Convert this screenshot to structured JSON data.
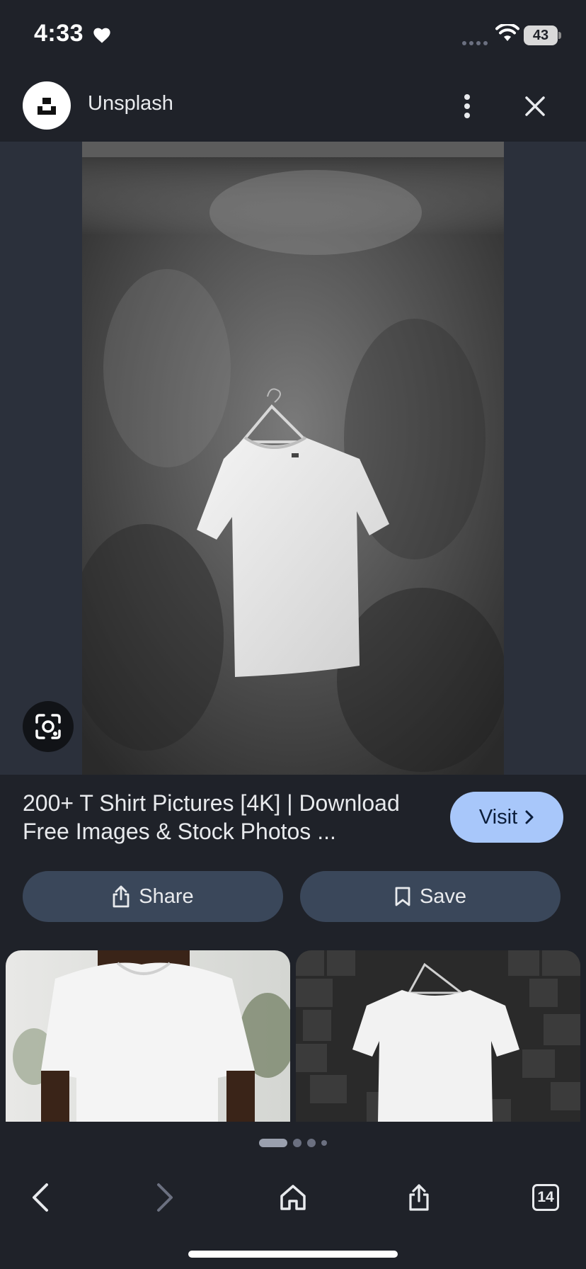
{
  "status_bar": {
    "time": "4:33",
    "battery": "43"
  },
  "header": {
    "site_name": "Unsplash"
  },
  "result": {
    "title": "200+ T Shirt Pictures [4K] | Download Free Images & Stock Photos ...",
    "visit_label": "Visit"
  },
  "actions": {
    "share_label": "Share",
    "save_label": "Save"
  },
  "toolbar": {
    "tabs_count": "14"
  },
  "icons": {
    "heart": "heart-icon",
    "more": "more-vert-icon",
    "close": "close-icon",
    "lens": "google-lens-icon",
    "back": "chevron-left-icon",
    "forward": "chevron-right-icon",
    "home": "home-icon",
    "share": "share-icon",
    "save": "bookmark-icon"
  },
  "colors": {
    "background": "#1f2229",
    "image_backdrop": "#2b303b",
    "visit_button": "#a8c7fa",
    "action_button": "#3a475a"
  },
  "pager": {
    "count": 4,
    "active_index": 0
  }
}
